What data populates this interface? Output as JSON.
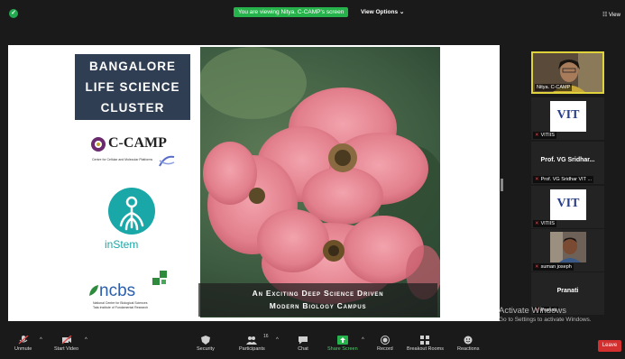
{
  "topbar": {
    "viewing_text": "You are viewing Nitya. C-CAMP's screen",
    "view_options": "View Options ⌄",
    "view_button": "☷ View"
  },
  "slide": {
    "title_lines": [
      "BANGALORE",
      "LIFE SCIENCE",
      "CLUSTER"
    ],
    "ccamp_logo": "C-CAMP",
    "ccamp_sub": "Centre for Cellular and Molecular Platforms",
    "instem_logo": "inStem",
    "ncbs_logo": "ncbs",
    "ncbs_sub_1": "National Centre for Biological Sciences",
    "ncbs_sub_2": "Tata Institute of Fundamental Research",
    "caption_line1": "An Exciting Deep Science Driven",
    "caption_line2": "Modern Biology Campus"
  },
  "participants": [
    {
      "label": "Nitya. C-CAMP",
      "type": "video"
    },
    {
      "label": "VITIIS",
      "type": "vit",
      "logo": "VIT"
    },
    {
      "label": "Prof. VG Sridhar VIT ...",
      "type": "name",
      "display": "Prof. VG Sridhar..."
    },
    {
      "label": "VITIIS",
      "type": "vit",
      "logo": "VIT"
    },
    {
      "label": "suman joseph",
      "type": "video"
    },
    {
      "label": "Pranati",
      "type": "name",
      "display": "Pranati"
    }
  ],
  "watermark": {
    "line1": "Activate Windows",
    "line2": "Go to Settings to activate Windows."
  },
  "toolbar": {
    "unmute": "Unmute",
    "start_video": "Start Video",
    "security": "Security",
    "participants": "Participants",
    "participants_count": "16",
    "chat": "Chat",
    "share_screen": "Share Screen",
    "record": "Record",
    "breakout_rooms": "Breakout Rooms",
    "reactions": "Reactions",
    "leave": "Leave"
  },
  "colors": {
    "accent_green": "#27b34b",
    "leave_red": "#d32f2f",
    "slide_navy": "#2f3e52"
  }
}
